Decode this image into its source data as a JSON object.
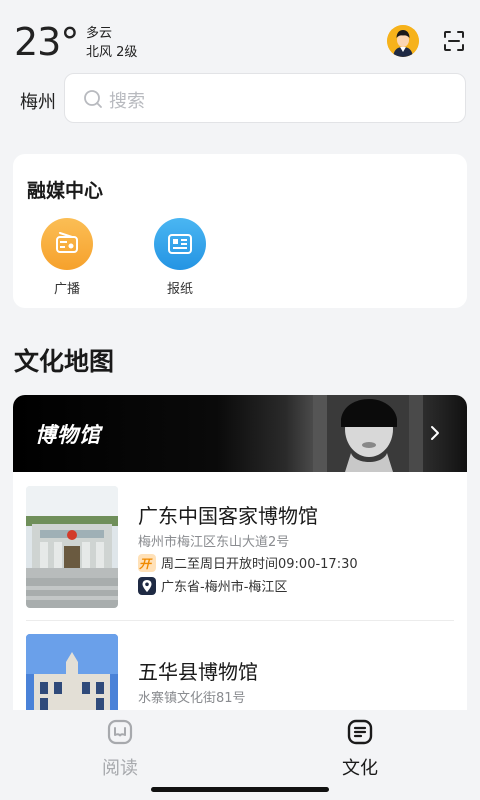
{
  "header": {
    "temperature": "23°",
    "condition": "多云",
    "wind": "北风 2级",
    "city": "梅州",
    "search_placeholder": "搜索"
  },
  "media_center": {
    "title": "融媒中心",
    "items": [
      {
        "label": "广播",
        "icon": "radio-icon",
        "color": "#f8a83a"
      },
      {
        "label": "报纸",
        "icon": "newspaper-icon",
        "color": "#2f9fe8"
      }
    ]
  },
  "culture_map": {
    "title": "文化地图",
    "banner_title": "博物馆",
    "museums": [
      {
        "name": "广东中国客家博物馆",
        "address": "梅州市梅江区东山大道2号",
        "hours_badge": "开",
        "hours": "周二至周日开放时间09:00-17:30",
        "location": "广东省-梅州市-梅江区"
      },
      {
        "name": "五华县博物馆",
        "address": "水寨镇文化街81号"
      }
    ]
  },
  "bottom_nav": {
    "items": [
      {
        "label": "阅读",
        "icon": "read-icon",
        "active": false
      },
      {
        "label": "文化",
        "icon": "culture-icon",
        "active": true
      }
    ]
  },
  "colors": {
    "accent_orange": "#f6b21b",
    "inactive": "#a7a9ad",
    "active": "#1a1a1a"
  }
}
